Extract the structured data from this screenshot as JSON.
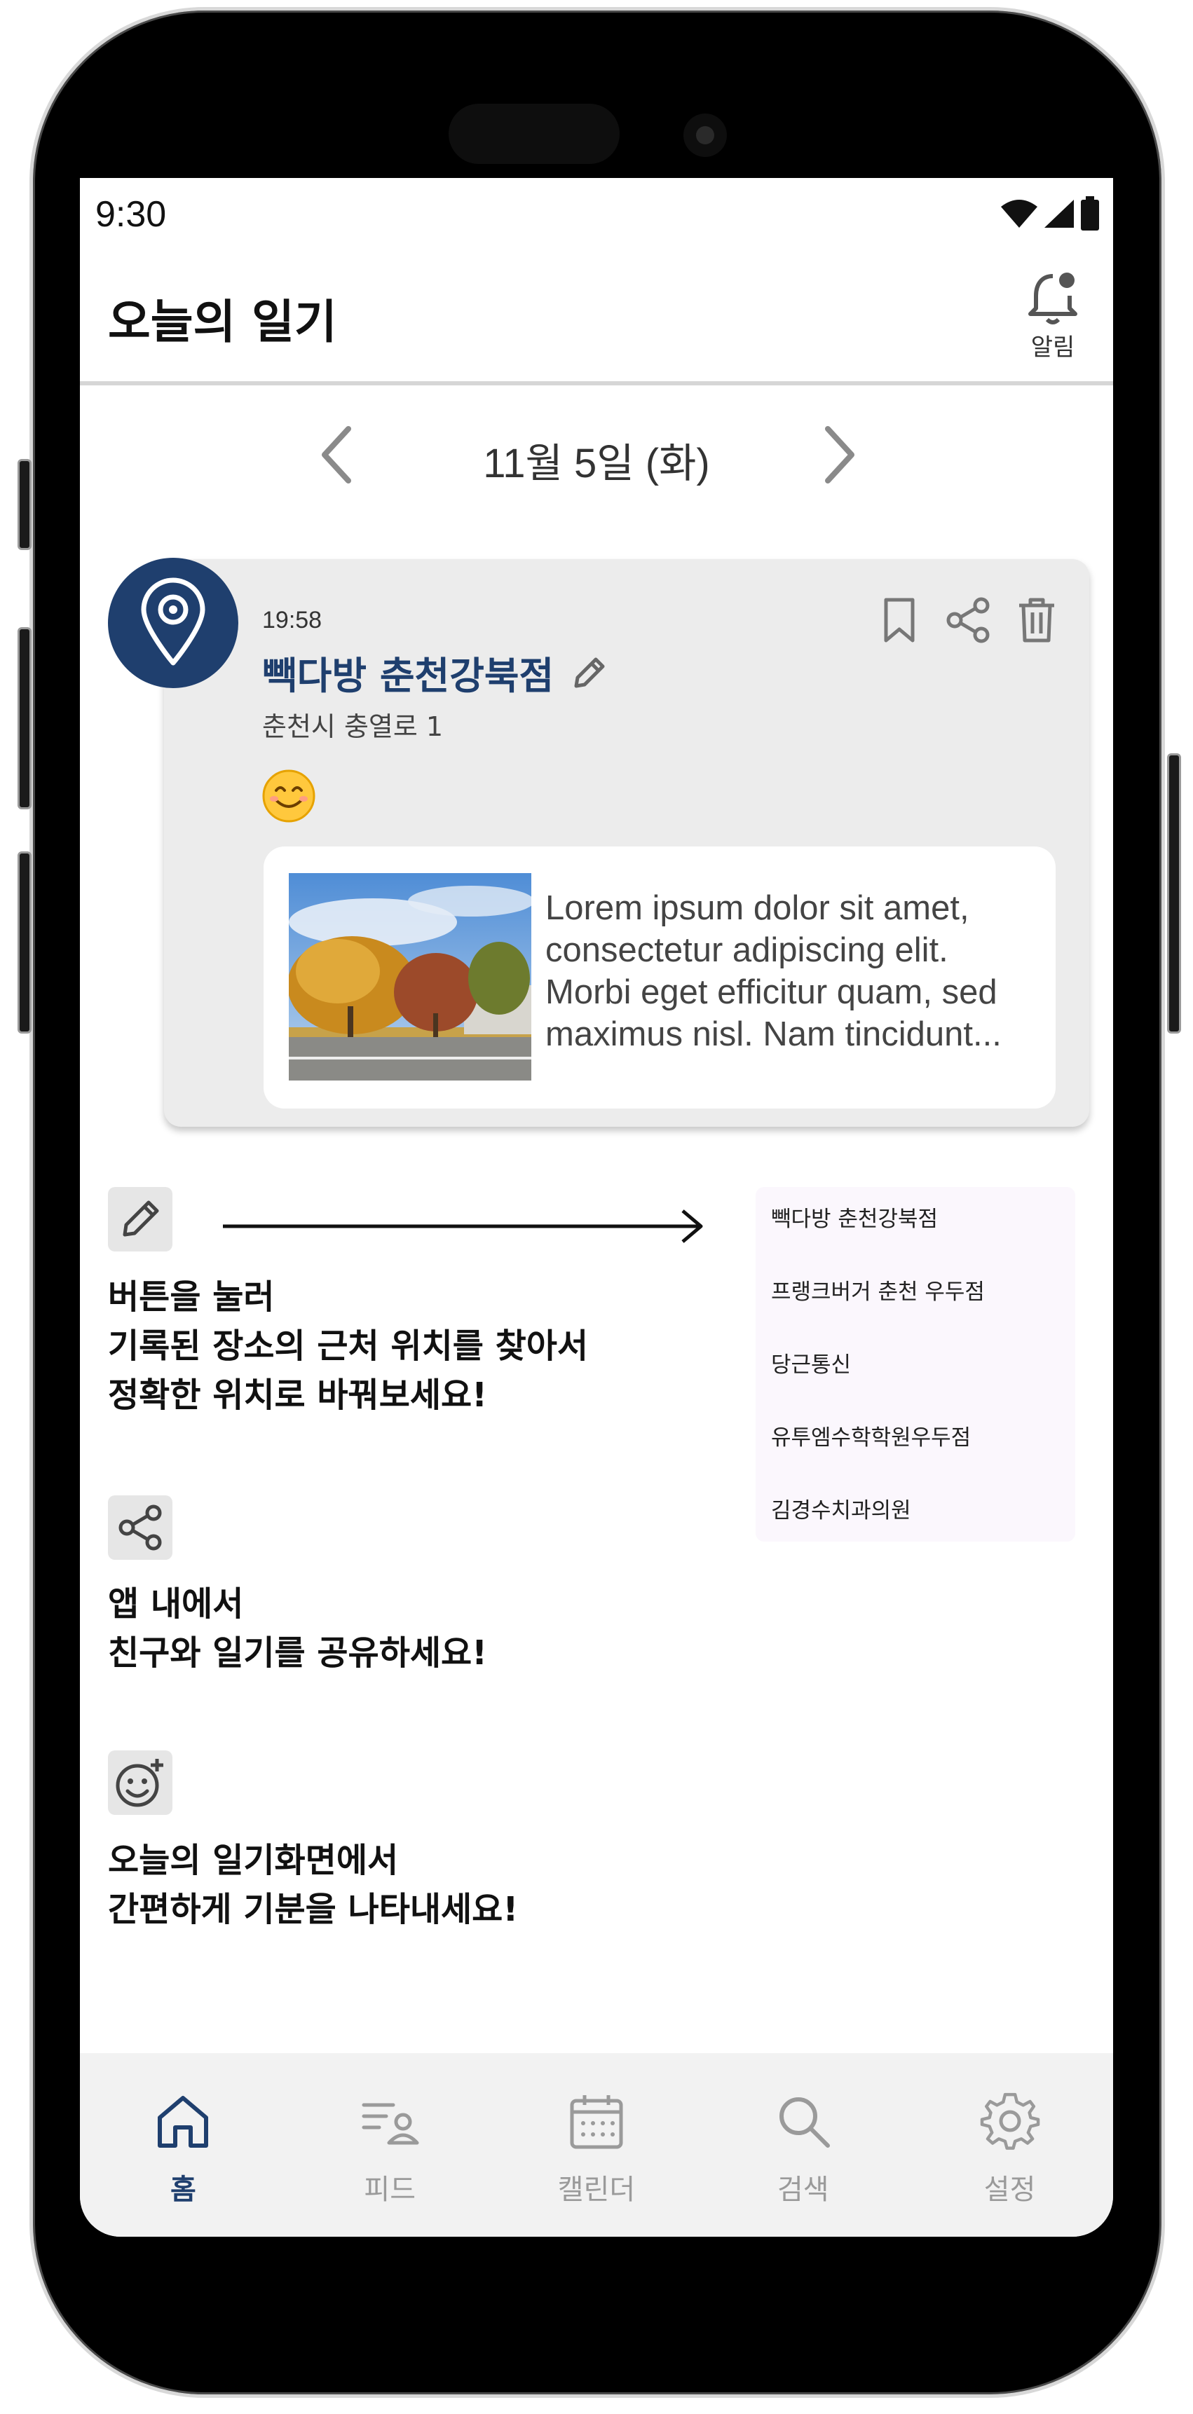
{
  "status_bar": {
    "time": "9:30",
    "icons": [
      "wifi-icon",
      "signal-icon",
      "battery-icon"
    ]
  },
  "header": {
    "title": "오늘의 일기",
    "bell_label": "알림"
  },
  "date_nav": {
    "date": "11월 5일 (화)"
  },
  "entry": {
    "time": "19:58",
    "place": "빽다방 춘천강북점",
    "address": "춘천시 충열로 1",
    "excerpt": "Lorem ipsum dolor sit amet, consectetur adipiscing elit. Morbi eget efficitur quam, sed maximus nisl. Nam tincidunt..."
  },
  "tips": [
    {
      "icon": "pencil-icon",
      "lines": [
        "버튼을 눌러",
        "기록된 장소의 근처 위치를 찾아서",
        "정확한 위치로 바꿔보세요!"
      ]
    },
    {
      "icon": "share-icon",
      "lines": [
        "앱 내에서",
        "친구와 일기를 공유하세요!"
      ]
    },
    {
      "icon": "add-emoji-icon",
      "lines": [
        "오늘의 일기화면에서",
        "간편하게 기분을 나타내세요!"
      ]
    }
  ],
  "nearby_places": [
    "빽다방 춘천강북점",
    "프랭크버거 춘천 우두점",
    "당근통신",
    "유투엠수학학원우두점",
    "김경수치과의원"
  ],
  "bottom_nav": [
    {
      "label": "홈",
      "icon": "home-icon",
      "active": true
    },
    {
      "label": "피드",
      "icon": "feed-icon",
      "active": false
    },
    {
      "label": "캘린더",
      "icon": "calendar-icon",
      "active": false
    },
    {
      "label": "검색",
      "icon": "search-icon",
      "active": false
    },
    {
      "label": "설정",
      "icon": "settings-icon",
      "active": false
    }
  ],
  "colors": {
    "accent": "#1f3f6e",
    "inactive": "#9a9a9a",
    "card_bg": "#ececec",
    "nav_bg": "#f2f2f2"
  }
}
